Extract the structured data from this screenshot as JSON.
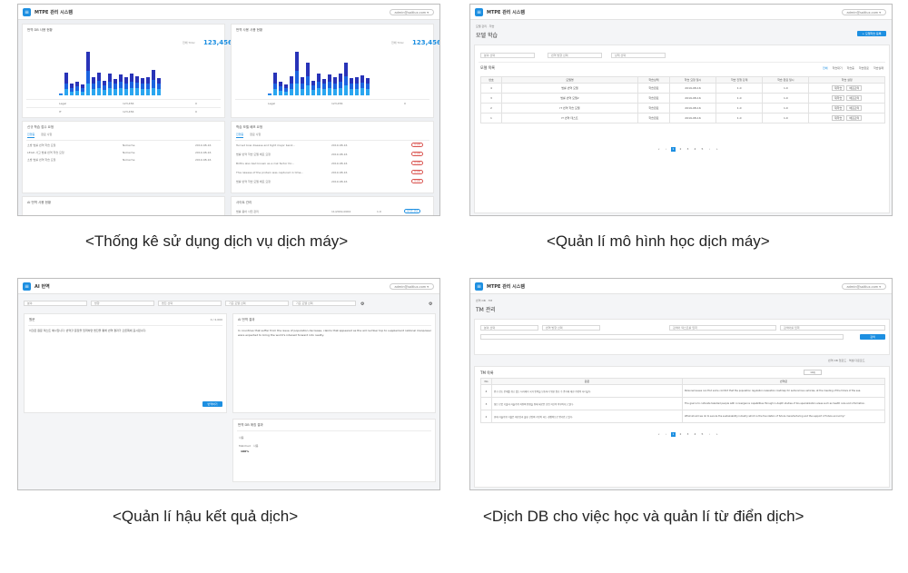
{
  "captions": {
    "c1": "<Thống kê sử dụng dịch vụ dịch máy>",
    "c2": "<Quản lí mô hình học dịch máy>",
    "c3": "<Quản lí hậu kết quả dịch>",
    "c4": "<Dịch DB cho việc học và quản lí từ điển dịch>"
  },
  "app": {
    "title": "MTPE 관리 시스템",
    "title_ai": "AI 번역",
    "user": "admin@saltlux.com ▾"
  },
  "dashboard": {
    "chart1_title": "번역 DB 사용 현황",
    "chart2_title": "번역 사용 사용 현황",
    "total_label": "전체 Total",
    "total_value": "123,456",
    "stat_rows": [
      [
        "Legal",
        "123,456",
        "0"
      ],
      [
        "IT",
        "123,456",
        "0"
      ]
    ],
    "list1_title": "신규 학습 접수 요청",
    "list2_title": "학습 모델 배포 요청",
    "tab1": "진행중",
    "tab2": "완료 사항",
    "list1_rows": [
      [
        "소방 법률 번역 학습 요청",
        "NoCache",
        "2019-08-16"
      ],
      [
        "LEGO 사고 법률 번역 학습 요청",
        "NoCache",
        "2019-08-16"
      ],
      [
        "소방 법률 번역 학습 요청",
        "NoCache",
        "2019-08-16"
      ]
    ],
    "list2_rows": [
      [
        "Turned bow disease and tight major bend...",
        "2019-08-16",
        "진행중"
      ],
      [
        "법률 번역 학습 모델 배포 요청",
        "2019-08-16",
        "진행중"
      ],
      [
        "Births also bad known as a risk factor for...",
        "2019-08-16",
        "진행중"
      ],
      [
        "The release of the protein was captured in time...",
        "2019-08-16",
        "진행중"
      ],
      [
        "법률 번역 학습 모델 배포 요청",
        "2019-08-16",
        "진행중"
      ]
    ],
    "bottom_left_title": "AI 번역 사용 현황",
    "bottom_right_title": "사이트 관리",
    "bottom_right_row": [
      "법률 용어 사전 관리",
      "11/2019-0004",
      "1.0",
      "사이트 관리"
    ]
  },
  "model": {
    "breadcrumb": "모델 관리 · 학습",
    "page_title": "모델 학습",
    "new_button": "+ 모델학습 등록",
    "filters": [
      "분야 선택",
      "번역 방향 선택",
      "상태 선택"
    ],
    "list_title": "모델 목록",
    "legend": [
      "전체",
      "학습대기",
      "학습중",
      "학습완료",
      "학습실패"
    ],
    "columns": [
      "번호",
      "모델명",
      "학습상태",
      "학습 요청 일시",
      "학습 진행 단계",
      "학습 완료 일시",
      "학습 설정"
    ],
    "rows": [
      [
        "4",
        "법률 번역 모델",
        "학습완료",
        "2019-08-16",
        "1.0",
        "1.0"
      ],
      [
        "3",
        "법률 번역 모델2",
        "학습완료",
        "2019-08-16",
        "1.0",
        "1.0"
      ],
      [
        "2",
        "IT 번역 학습 모델",
        "학습완료",
        "2019-08-16",
        "1.0",
        "1.0"
      ],
      [
        "1",
        "IT 번역 테스트",
        "학습완료",
        "2019-08-16",
        "1.0",
        "1.0"
      ]
    ],
    "row_btn1": "재학습",
    "row_btn2": "배포관리",
    "pages": [
      "«",
      "‹",
      "1",
      "2",
      "3",
      "4",
      "5",
      "›",
      "»"
    ]
  },
  "post": {
    "filters": [
      "분야",
      "방향",
      "엔진 선택",
      "기준 모델 선택",
      "기준 모델 선택"
    ],
    "source_title": "원문",
    "source_meta": "0 / 2,000",
    "source_text": "이것은 원문 텍스트 예시입니다. 번역할 문장을 입력하면 엔진을 통해 번역 결과가 오른쪽에 표시됩니다.",
    "translate_btn": "번역하기",
    "result_title": "AI 번역 결과",
    "result_text": "In countries that suffer from the issue of population decrease, claims that appeared as the aid number top to supplement national manpower were expected to bring the world's interest forward into reality.",
    "db_title": "번역 DB 매칭 결과",
    "db_label": "사용",
    "db_sub_label": "Matched",
    "db_value": "100%",
    "db_use": "사용"
  },
  "tm": {
    "breadcrumb": "번역 DB · TM",
    "page_title": "TM 관리",
    "filters": [
      "분야 선택",
      "번역 방향 선택",
      "검색어 텍스트를 입력",
      "검색어를 입력"
    ],
    "search_btn": "검색",
    "upload_text": "번역 DB 업로드 · 엑셀 다운로드",
    "list_title": "TM 목록",
    "col_source": "원문",
    "col_target": "번역문",
    "rows": [
      [
        "4",
        "인구 감소 문제를 겪고 있는 나라에서 국가 인력을 보충하기 위한 원조 수 증가에 대한 주장이 나타났다.",
        "Personal issues can find some comfort that the population regulation relaxation roadmap for autonomous vehicles, at the meeting of the future of the sea."
      ],
      [
        "3",
        "첨단 로봇 기술과 자율주행 차량의 융합을 통해 새로운 산업 혁신이 이루어지고 있다.",
        "The goal is to cultivate talented people with convergence capabilities through in-depth studies of bio-specialization areas such as health care and information."
      ],
      [
        "2",
        "현재 자율주행 기술은 제조업과 물류 산업의 기반이 되는 경쟁력으로 평가받고 있다.",
        "What should we do to secure the sustainability industry which is the foundation of future manufacturing and the support of future economy?"
      ]
    ],
    "pages": [
      "«",
      "‹",
      "1",
      "2",
      "3",
      "4",
      "5",
      "›",
      "»"
    ],
    "view_count": "10개"
  },
  "colors": {
    "accent": "#1d8fe1",
    "bar_dark": "#2833b8",
    "bar_mid": "#1b63e0",
    "bar_light": "#2aa6f0"
  },
  "chart_data": [
    {
      "type": "bar",
      "values": [
        3,
        30,
        16,
        18,
        14,
        57,
        24,
        30,
        19,
        29,
        21,
        27,
        24,
        29,
        25,
        22,
        24,
        33,
        22
      ],
      "series": [
        {
          "values": [
            1,
            14,
            6,
            6,
            4,
            25,
            8,
            11,
            6,
            11,
            6,
            9,
            8,
            11,
            8,
            7,
            8,
            13,
            6
          ]
        },
        {
          "values": [
            1,
            8,
            5,
            6,
            5,
            16,
            8,
            9,
            6,
            9,
            7,
            9,
            8,
            9,
            8,
            7,
            8,
            10,
            8
          ]
        },
        {
          "values": [
            1,
            8,
            5,
            6,
            5,
            16,
            8,
            10,
            7,
            9,
            8,
            9,
            8,
            9,
            9,
            8,
            8,
            10,
            8
          ]
        }
      ]
    },
    {
      "type": "bar",
      "values": [
        3,
        30,
        18,
        14,
        25,
        57,
        24,
        43,
        19,
        29,
        21,
        27,
        24,
        29,
        43,
        22,
        24,
        26,
        22
      ],
      "series": [
        {
          "values": [
            1,
            14,
            6,
            4,
            9,
            25,
            8,
            18,
            6,
            11,
            6,
            9,
            8,
            11,
            18,
            7,
            8,
            9,
            6
          ]
        },
        {
          "values": [
            1,
            8,
            6,
            5,
            8,
            16,
            8,
            12,
            6,
            9,
            7,
            9,
            8,
            9,
            12,
            7,
            8,
            8,
            8
          ]
        },
        {
          "values": [
            1,
            8,
            6,
            5,
            8,
            16,
            8,
            13,
            7,
            9,
            8,
            9,
            8,
            9,
            13,
            8,
            8,
            9,
            8
          ]
        }
      ]
    }
  ]
}
